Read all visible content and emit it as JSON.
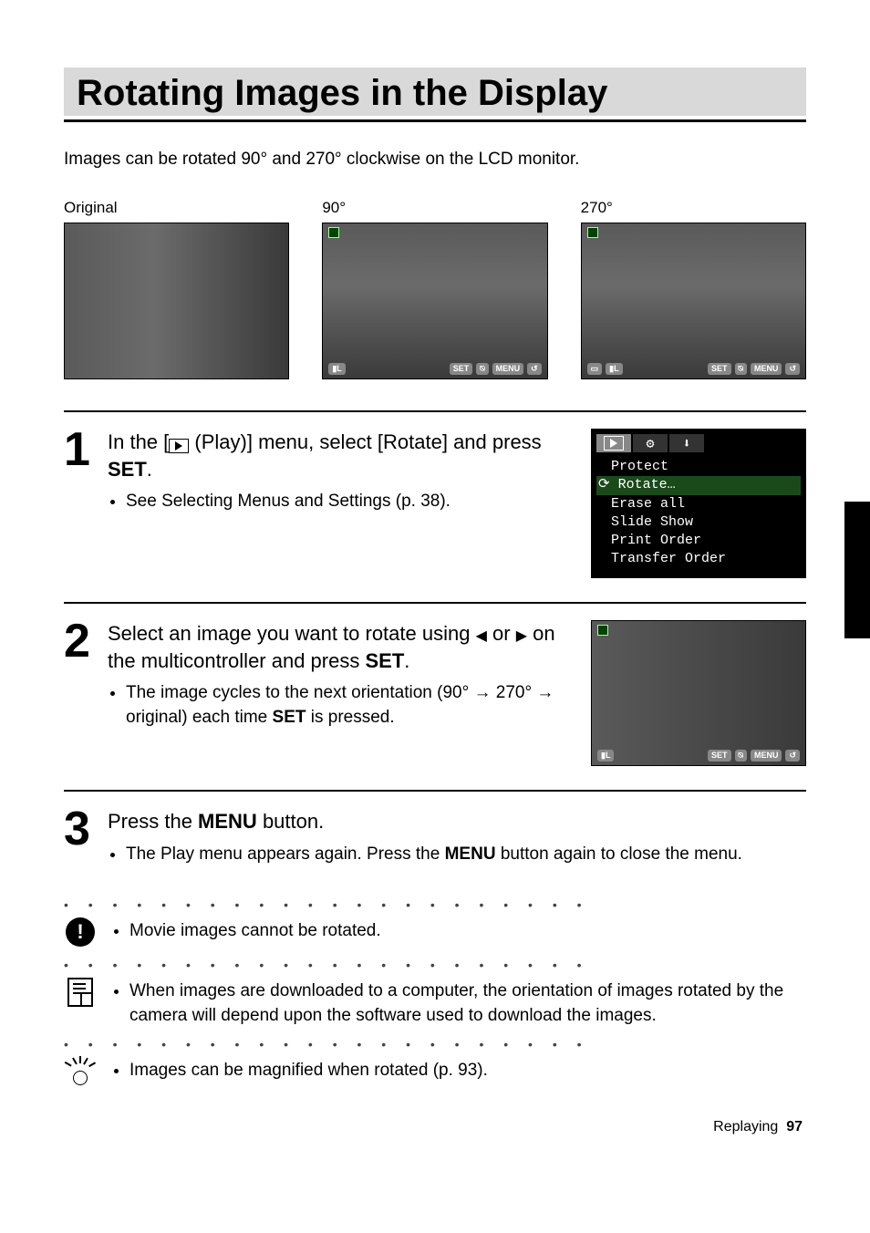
{
  "title": "Rotating Images in the Display",
  "intro": "Images can be rotated 90° and 270° clockwise on the LCD monitor.",
  "examples": [
    {
      "label": "Original"
    },
    {
      "label": "90°"
    },
    {
      "label": "270°"
    }
  ],
  "lcd_chips": {
    "set": "SET",
    "zoom": "⍉",
    "menu": "MENU",
    "back": "↺"
  },
  "steps": [
    {
      "num": "1",
      "head_parts": {
        "a": "In the [",
        "b": " (Play)] menu, select [Rotate] and press ",
        "set": "SET",
        "c": "."
      },
      "bullets": [
        "See Selecting Menus and Settings (p. 38)."
      ],
      "menu": {
        "items": [
          "Protect",
          "Rotate…",
          "Erase all",
          "Slide Show",
          "Print Order",
          "Transfer Order"
        ],
        "selected_index": 1
      }
    },
    {
      "num": "2",
      "head_parts": {
        "a": "Select an image you want to rotate using ",
        "left": "◀",
        "mid": " or ",
        "right": "▶",
        "b": " on the multicontroller and press ",
        "set": "SET",
        "c": "."
      },
      "bullets_rich": {
        "a": "The image cycles to the next orientation (90° ",
        "arr1": "→",
        "b": " 270° ",
        "arr2": "→",
        "c": " original) each time ",
        "set": "SET",
        "d": " is pressed."
      }
    },
    {
      "num": "3",
      "head_parts": {
        "a": "Press the ",
        "menu": "MENU",
        "b": " button."
      },
      "bullets_rich": {
        "a": "The Play menu appears again. Press the ",
        "menu": "MENU",
        "b": " button again to close the menu."
      }
    }
  ],
  "notes": {
    "warn": "Movie images cannot be rotated.",
    "info": "When images are downloaded to a computer, the orientation of images rotated by the camera will depend upon the software used to download the images.",
    "tip": "Images can be magnified when rotated (p. 93)."
  },
  "footer": {
    "section": "Replaying",
    "page": "97"
  },
  "dots": "• • • • • • • • • • • • • • • • • • • • • •"
}
